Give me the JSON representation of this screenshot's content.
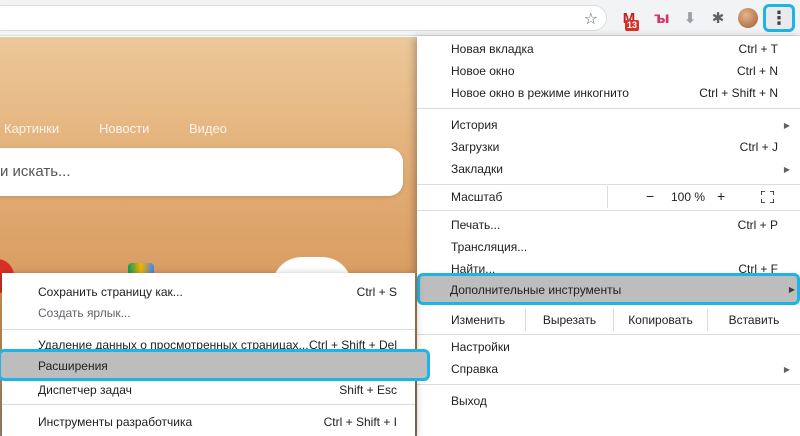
{
  "toolbar": {
    "badge_count": "13",
    "menu_glyph": "⋮"
  },
  "page": {
    "nav_images": "Картинки",
    "nav_news": "Новости",
    "nav_video": "Видео",
    "search_placeholder": "и искать..."
  },
  "main_menu": {
    "new_tab": {
      "label": "Новая вкладка",
      "shortcut": "Ctrl + T"
    },
    "new_window": {
      "label": "Новое окно",
      "shortcut": "Ctrl + N"
    },
    "incognito": {
      "label": "Новое окно в режиме инкогнито",
      "shortcut": "Ctrl + Shift + N"
    },
    "history": {
      "label": "История"
    },
    "downloads": {
      "label": "Загрузки",
      "shortcut": "Ctrl + J"
    },
    "bookmarks": {
      "label": "Закладки"
    },
    "zoom": {
      "label": "Масштаб",
      "minus": "−",
      "value": "100 %",
      "plus": "+"
    },
    "print": {
      "label": "Печать...",
      "shortcut": "Ctrl + P"
    },
    "cast": {
      "label": "Трансляция..."
    },
    "find": {
      "label": "Найти...",
      "shortcut": "Ctrl + F"
    },
    "more_tools": {
      "label": "Дополнительные инструменты"
    },
    "edit": {
      "label": "Изменить",
      "cut": "Вырезать",
      "copy": "Копировать",
      "paste": "Вставить"
    },
    "settings": {
      "label": "Настройки"
    },
    "help": {
      "label": "Справка"
    },
    "exit": {
      "label": "Выход"
    }
  },
  "sub_menu": {
    "save_page": {
      "label": "Сохранить страницу как...",
      "shortcut": "Ctrl + S"
    },
    "create_shortcut": {
      "label": "Создать ярлык..."
    },
    "clear_data": {
      "label": "Удаление данных о просмотренных страницах...",
      "shortcut": "Ctrl + Shift + Del"
    },
    "extensions": {
      "label": "Расширения"
    },
    "task_manager": {
      "label": "Диспетчер задач",
      "shortcut": "Shift + Esc"
    },
    "dev_tools": {
      "label": "Инструменты разработчика",
      "shortcut": "Ctrl + Shift + I"
    }
  },
  "colors": {
    "highlight_border": "#1fb4e6",
    "highlight_fill": "#bdbdbd"
  }
}
